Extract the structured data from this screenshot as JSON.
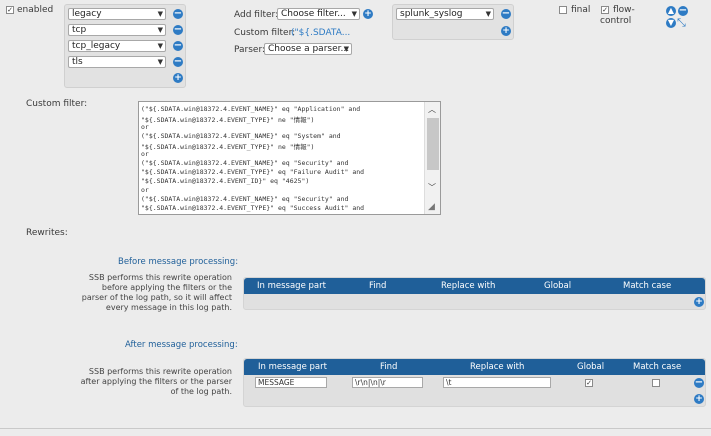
{
  "header": {
    "enabled_label": "enabled",
    "enabled_checked": true,
    "sources": [
      "legacy",
      "tcp",
      "tcp_legacy",
      "tls"
    ],
    "add_filter_label": "Add filter:",
    "add_filter_value": "Choose filter...",
    "custom_filter_label": "Custom filter:",
    "custom_filter_value": "(\"${.SDATA...",
    "parser_label": "Parser:",
    "parser_value": "Choose a parser...",
    "destination": "splunk_syslog",
    "final_label": "final",
    "final_checked": false,
    "flow_control_label_1": "flow-",
    "flow_control_label_2": "control",
    "flow_control_checked": true
  },
  "custom_filter": {
    "label": "Custom filter:",
    "lines": [
      "(\"${.SDATA.win@18372.4.EVENT_NAME}\" eq \"Application\" and",
      "\"${.SDATA.win@18372.4.EVENT_TYPE}\" ne \"情報\")",
      "or",
      "(\"${.SDATA.win@18372.4.EVENT_NAME}\" eq \"System\" and",
      "\"${.SDATA.win@18372.4.EVENT_TYPE}\" ne \"情報\")",
      "or",
      "(\"${.SDATA.win@18372.4.EVENT_NAME}\" eq \"Security\" and",
      "\"${.SDATA.win@18372.4.EVENT_TYPE}\" eq \"Failure Audit\" and",
      "\"${.SDATA.win@18372.4.EVENT_ID}\" eq \"4625\")",
      "or",
      "(\"${.SDATA.win@18372.4.EVENT_NAME}\" eq \"Security\" and",
      "\"${.SDATA.win@18372.4.EVENT_TYPE}\" eq \"Success Audit\" and"
    ]
  },
  "rewrites": {
    "label": "Rewrites:",
    "before": {
      "title": "Before message processing:",
      "description": [
        "SSB performs this rewrite operation",
        "before applying the filters or the",
        "parser of the log path, so it will affect",
        "every message in this log path."
      ],
      "columns": [
        "In message part",
        "Find",
        "Replace with",
        "Global",
        "Match case"
      ]
    },
    "after": {
      "title": "After message processing:",
      "description": [
        "SSB performs this rewrite operation",
        "after applying the filters or the parser",
        "of the log path."
      ],
      "columns": [
        "In message part",
        "Find",
        "Replace with",
        "Global",
        "Match case"
      ],
      "rows": [
        {
          "message_part": "MESSAGE",
          "find": "\\r\\n|\\n|\\r",
          "replace": "\\t",
          "global": true,
          "match_case": false
        }
      ]
    }
  }
}
